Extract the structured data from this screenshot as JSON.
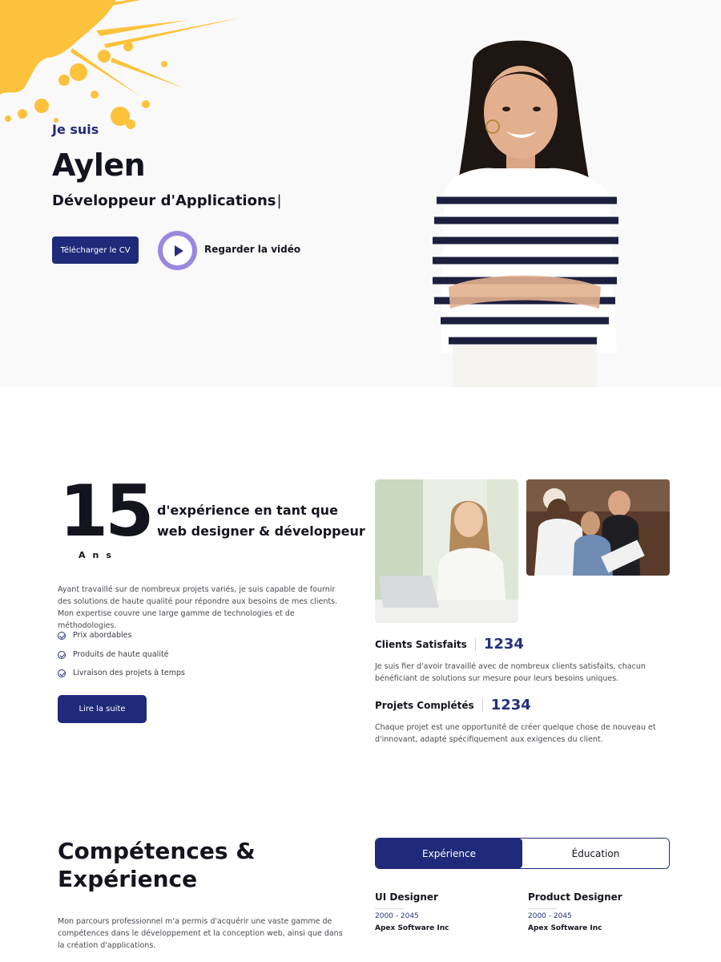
{
  "hero": {
    "kicker": "Je suis",
    "name": "Aylen",
    "role": "Développeur d'Applications",
    "caret": "|",
    "cv_button": "Télécharger le CV",
    "video_label": "Regarder la vidéo"
  },
  "about": {
    "years_number": "15",
    "years_unit": "Ans",
    "title": "d'expérience en tant que web designer & développeur",
    "paragraph": "Ayant travaillé sur de nombreux projets variés, je suis capable de fournir des solutions de haute qualité pour répondre aux besoins de mes clients. Mon expertise couvre une large gamme de technologies et de méthodologies.",
    "features": [
      "Prix abordables",
      "Produits de haute qualité",
      "Livraison des projets à temps"
    ],
    "read_more": "Lire la suite"
  },
  "stats": [
    {
      "label": "Clients Satisfaits",
      "value": "1234",
      "text": "Je suis fier d'avoir travaillé avec de nombreux clients satisfaits, chacun bénéficiant de solutions sur mesure pour leurs besoins uniques."
    },
    {
      "label": "Projets Complétés",
      "value": "1234",
      "text": "Chaque projet est une opportunité de créer quelque chose de nouveau et d'innovant, adapté spécifiquement aux exigences du client."
    }
  ],
  "skills": {
    "title": "Compétences & Expérience",
    "paragraph": "Mon parcours professionnel m'a permis d'acquérir une vaste gamme de compétences dans le développement et la conception web, ainsi que dans la création d'applications.",
    "tabs": [
      "Expérience",
      "Éducation"
    ],
    "jobs": [
      {
        "title": "UI Designer",
        "years": "2000 - 2045",
        "company": "Apex Software Inc"
      },
      {
        "title": "Product Designer",
        "years": "2000 - 2045",
        "company": "Apex Software Inc"
      }
    ]
  },
  "colors": {
    "accent": "#1f2a7a",
    "splash": "#fcc23c",
    "play_ring": "#9a87e0"
  },
  "icons": {
    "play": "play-icon",
    "check": "check-circle-icon"
  }
}
